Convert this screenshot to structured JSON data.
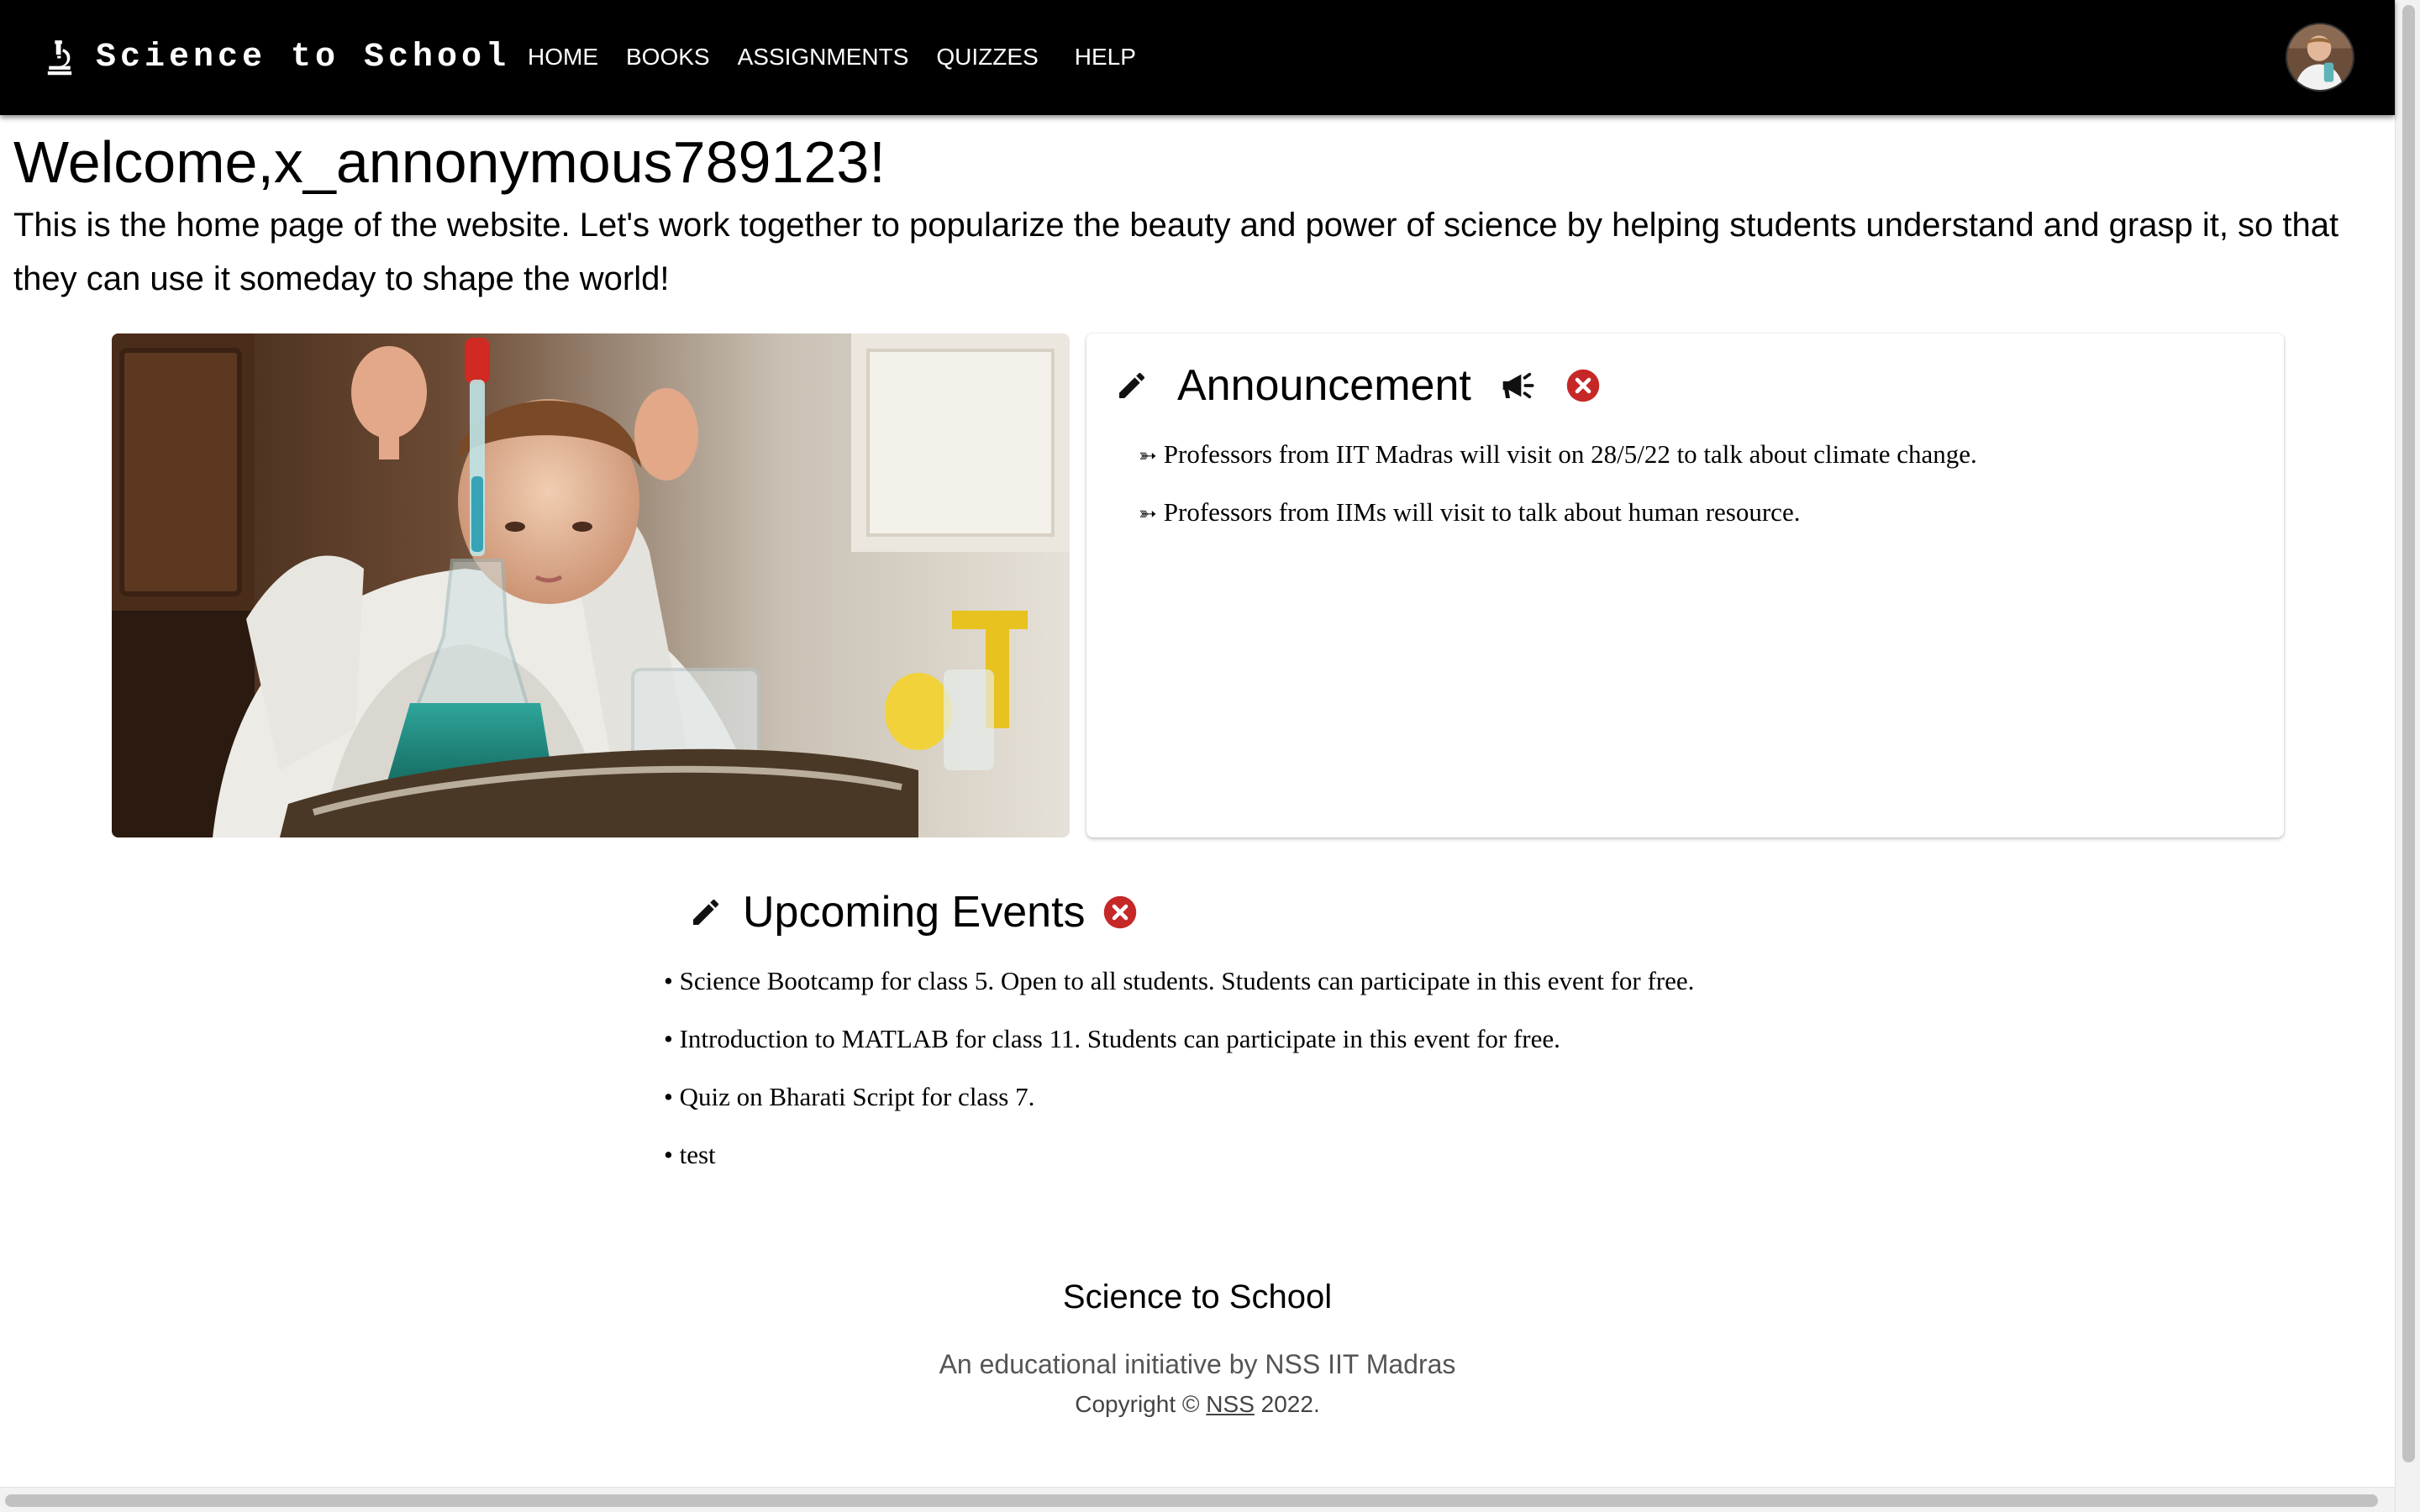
{
  "nav": {
    "brand_icon": "microscope-icon",
    "brand": "Science to School",
    "links": [
      "HOME",
      "BOOKS",
      "ASSIGNMENTS",
      "QUIZZES",
      "HELP"
    ],
    "avatar_icon": "user-avatar"
  },
  "welcome": "Welcome,x_annonymous789123!",
  "intro": "This is the home page of the website. Let's work together to popularize the beauty and power of science by helping students understand and grasp it, so that they can use it someday to shape the world!",
  "announcement": {
    "title": "Announcement",
    "icons": [
      "pencil-icon",
      "megaphone-icon",
      "close-circle-icon"
    ],
    "bullet": "➳",
    "items": [
      "Professors from IIT Madras will visit on 28/5/22 to talk about climate change.",
      "Professors from IIMs will visit to talk about human resource."
    ]
  },
  "events": {
    "title": "Upcoming Events",
    "icons": [
      "pencil-icon",
      "close-circle-icon"
    ],
    "bullet": "•",
    "items": [
      "Science Bootcamp for class 5. Open to all students. Students can participate in this event for free.",
      "Introduction to MATLAB for class 11. Students can participate in this event for free.",
      "Quiz on Bharati Script for class 7.",
      "test"
    ]
  },
  "footer": {
    "title": "Science to School",
    "tagline": "An educational initiative by NSS IIT Madras",
    "copyright_prefix": "Copyright © ",
    "copyright_link": "NSS",
    "copyright_suffix": " 2022."
  },
  "colors": {
    "navbar": "#000000",
    "close_icon": "#c62828",
    "text": "#000000",
    "muted_text": "#555555"
  }
}
